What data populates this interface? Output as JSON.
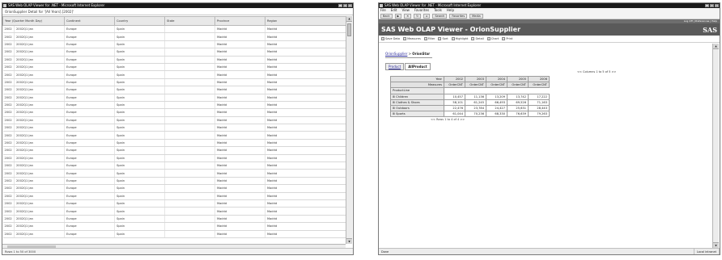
{
  "left_window": {
    "title": "SAS Web OLAP Viewer for .NET - Microsoft Internet Explorer",
    "subtitle": "OrionSupplier Detail for '[All Years].[2002]'",
    "columns": [
      "Year (Quarter Month Day)",
      "Continent",
      "Country",
      "State",
      "Province",
      "Region"
    ],
    "rows": [
      [
        "2002",
        "2002Q1 Jan",
        "Europe",
        "Spain",
        "",
        "Madrid",
        "Madrid"
      ],
      [
        "2002",
        "2002Q1 Jan",
        "Europe",
        "Spain",
        "",
        "Madrid",
        "Madrid"
      ],
      [
        "2002",
        "2002Q1 Jan",
        "Europe",
        "Spain",
        "",
        "Madrid",
        "Madrid"
      ],
      [
        "2002",
        "2002Q1 Jan",
        "Europe",
        "Spain",
        "",
        "Madrid",
        "Madrid"
      ],
      [
        "2002",
        "2002Q1 Jan",
        "Europe",
        "Spain",
        "",
        "Madrid",
        "Madrid"
      ],
      [
        "2002",
        "2002Q1 Jan",
        "Europe",
        "Spain",
        "",
        "Madrid",
        "Madrid"
      ],
      [
        "2002",
        "2002Q1 Jan",
        "Europe",
        "Spain",
        "",
        "Madrid",
        "Madrid"
      ],
      [
        "2002",
        "2002Q1 Jan",
        "Europe",
        "Spain",
        "",
        "Madrid",
        "Madrid"
      ],
      [
        "2002",
        "2002Q1 Jan",
        "Europe",
        "Spain",
        "",
        "Madrid",
        "Madrid"
      ],
      [
        "2002",
        "2002Q1 Jan",
        "Europe",
        "Spain",
        "",
        "Madrid",
        "Madrid"
      ],
      [
        "2002",
        "2002Q1 Jan",
        "Europe",
        "Spain",
        "",
        "Madrid",
        "Madrid"
      ],
      [
        "2002",
        "2002Q1 Jan",
        "Europe",
        "Spain",
        "",
        "Madrid",
        "Madrid"
      ],
      [
        "2002",
        "2002Q1 Jan",
        "Europe",
        "Spain",
        "",
        "Madrid",
        "Madrid"
      ],
      [
        "2002",
        "2002Q1 Jan",
        "Europe",
        "Spain",
        "",
        "Madrid",
        "Madrid"
      ],
      [
        "2002",
        "2002Q1 Jan",
        "Europe",
        "Spain",
        "",
        "Madrid",
        "Madrid"
      ],
      [
        "2002",
        "2002Q1 Jan",
        "Europe",
        "Spain",
        "",
        "Madrid",
        "Madrid"
      ],
      [
        "2002",
        "2002Q1 Jan",
        "Europe",
        "Spain",
        "",
        "Madrid",
        "Madrid"
      ],
      [
        "2002",
        "2002Q1 Jan",
        "Europe",
        "Spain",
        "",
        "Madrid",
        "Madrid"
      ],
      [
        "2002",
        "2002Q1 Jan",
        "Europe",
        "Spain",
        "",
        "Madrid",
        "Madrid"
      ],
      [
        "2002",
        "2002Q1 Jan",
        "Europe",
        "Spain",
        "",
        "Madrid",
        "Madrid"
      ],
      [
        "2002",
        "2002Q1 Jan",
        "Europe",
        "Spain",
        "",
        "Madrid",
        "Madrid"
      ],
      [
        "2002",
        "2002Q1 Jan",
        "Europe",
        "Spain",
        "",
        "Madrid",
        "Madrid"
      ],
      [
        "2002",
        "2002Q1 Jan",
        "Europe",
        "Spain",
        "",
        "Madrid",
        "Madrid"
      ],
      [
        "2002",
        "2002Q1 Jan",
        "Europe",
        "Spain",
        "",
        "Madrid",
        "Madrid"
      ],
      [
        "2002",
        "2002Q1 Jan",
        "Europe",
        "Spain",
        "",
        "Madrid",
        "Madrid"
      ],
      [
        "2002",
        "2002Q1 Jan",
        "Europe",
        "Spain",
        "",
        "Madrid",
        "Madrid"
      ],
      [
        "2002",
        "2002Q1 Jan",
        "Europe",
        "Spain",
        "",
        "Madrid",
        "Madrid"
      ],
      [
        "2002",
        "2002Q1 Jan",
        "Europe",
        "Spain",
        "",
        "Madrid",
        "Madrid"
      ]
    ],
    "pager": "Rows 1 to 50 of 3000"
  },
  "right_window": {
    "title": "SAS Web OLAP Viewer for .NET - Microsoft Internet Explorer",
    "menu": [
      "File",
      "Edit",
      "View",
      "Favorites",
      "Tools",
      "Help"
    ],
    "nav": [
      "Back",
      "Search",
      "Favorites",
      "Media"
    ],
    "links": "Log Off | Preferences | Help",
    "app_title": "SAS Web OLAP Viewer - OrionSupplier",
    "logo": "SAS",
    "toolbar": [
      "Save Data",
      "Measures",
      "Filter",
      "Sort",
      "Highlight",
      "Detail",
      "Chart",
      "Print"
    ],
    "breadcrumb": {
      "link": "OrionSupplier",
      "current": "OrionStar"
    },
    "tabs": [
      "Product",
      "AllProduct"
    ],
    "pivot_nav": "Columns 1 to 5 of 5",
    "pivot": {
      "year_label": "Year",
      "years": [
        "2002",
        "2003",
        "2004",
        "2005",
        "2006"
      ],
      "measure_label": "Measures",
      "measures": [
        "OrderCNT",
        "OrderCNT",
        "OrderCNT",
        "OrderCNT",
        "OrderCNT"
      ],
      "dimension_label": "ProductLine",
      "rows": [
        {
          "label": "Children",
          "values": [
            "10,457",
            "11,136",
            "13,209",
            "13,742",
            "17,222"
          ]
        },
        {
          "label": "Clothes & Shoes",
          "values": [
            "58,101",
            "61,245",
            "66,493",
            "69,526",
            "71,163"
          ]
        },
        {
          "label": "Outdoors",
          "values": [
            "22,476",
            "23,784",
            "24,427",
            "25,631",
            "28,443"
          ]
        },
        {
          "label": "Sports",
          "values": [
            "61,044",
            "70,236",
            "68,330",
            "76,639",
            "79,263"
          ]
        }
      ]
    },
    "pivot_footer": "Rows 1 to 4 of 4",
    "status": [
      "Done",
      "Local intranet"
    ]
  }
}
